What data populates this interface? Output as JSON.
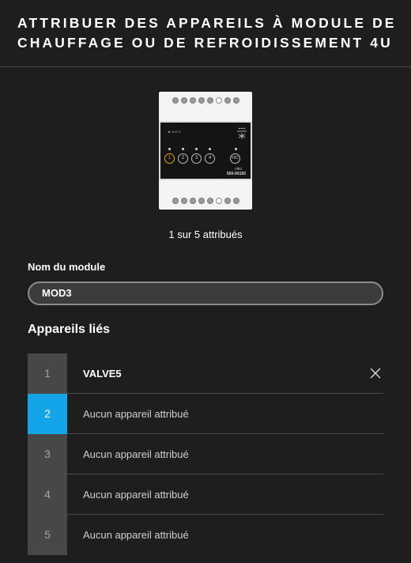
{
  "header": {
    "title": "ATTRIBUER DES APPAREILS À MODULE DE CHAUFFAGE OU DE REFROIDISSEMENT 4U"
  },
  "device": {
    "brand": "■ NIKO",
    "model": "niko",
    "reference": "550-00150",
    "buttons": [
      "1",
      "2",
      "3",
      "4",
      "H/C"
    ],
    "active_button": "1"
  },
  "status": {
    "assigned_count_text": "1 sur 5 attribués"
  },
  "module": {
    "name_label": "Nom du module",
    "name_value": "MOD3"
  },
  "linked": {
    "title": "Appareils liés",
    "rows": [
      {
        "number": "1",
        "text": "VALVE5",
        "assigned": true,
        "selected": false
      },
      {
        "number": "2",
        "text": "Aucun appareil attribué",
        "assigned": false,
        "selected": true
      },
      {
        "number": "3",
        "text": "Aucun appareil attribué",
        "assigned": false,
        "selected": false
      },
      {
        "number": "4",
        "text": "Aucun appareil attribué",
        "assigned": false,
        "selected": false
      },
      {
        "number": "5",
        "text": "Aucun appareil attribué",
        "assigned": false,
        "selected": false
      }
    ]
  },
  "icons": {
    "remove": "close-icon",
    "device_symbol": "heating-cooling-symbol-icon"
  },
  "colors": {
    "background": "#1e1e1e",
    "accent_blue": "#14a4e8",
    "active_button": "#e3a31e"
  }
}
